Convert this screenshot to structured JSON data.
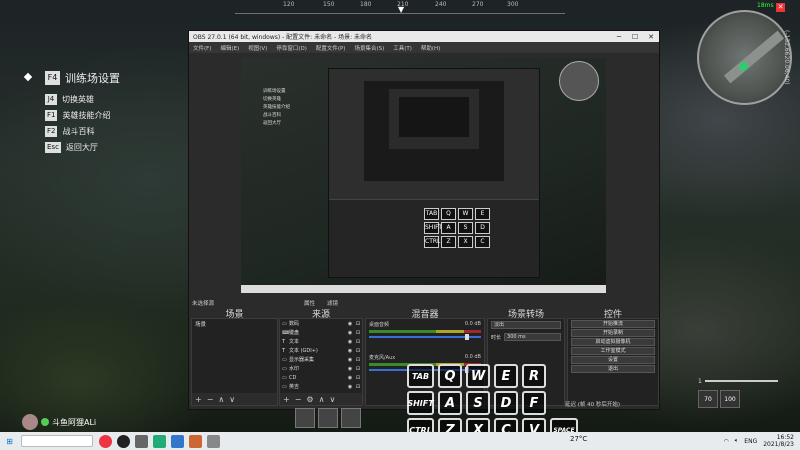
{
  "compass": {
    "ticks": [
      "120",
      "150",
      "180",
      "210",
      "240",
      "270",
      "300"
    ]
  },
  "hud_menu": {
    "main": {
      "key": "F4",
      "label": "训练场设置"
    },
    "items": [
      {
        "key": "J4",
        "label": "切换英雄"
      },
      {
        "key": "F1",
        "label": "英雄技能介绍"
      },
      {
        "key": "F2",
        "label": "战斗百科"
      },
      {
        "key": "Esc",
        "label": "返回大厅"
      }
    ]
  },
  "signal": "18ms",
  "coords": "(-132,6620.06,40)",
  "obs": {
    "title": "OBS 27.0.1 (64 bit, windows) - 配置文件: 未命名 - 场景: 未命名",
    "menu": [
      "文件(F)",
      "编辑(E)",
      "视图(V)",
      "停靠窗口(D)",
      "配置文件(P)",
      "场景集合(S)",
      "工具(T)",
      "帮助(H)"
    ],
    "scene_label": "未选择源",
    "properties": "属性",
    "filters": "滤镜",
    "dock_titles": [
      "场景",
      "来源",
      "混音器",
      "场景转场",
      "控件"
    ],
    "scenes": [
      "场景"
    ],
    "sources": [
      {
        "icon": "▭",
        "label": "数码"
      },
      {
        "icon": "⌨",
        "label": "键盘"
      },
      {
        "icon": "T",
        "label": "文本"
      },
      {
        "icon": "T",
        "label": "文本 (GDI+)"
      },
      {
        "icon": "▭",
        "label": "显示器采集"
      },
      {
        "icon": "▭",
        "label": "水印"
      },
      {
        "icon": "▭",
        "label": "CD"
      },
      {
        "icon": "▭",
        "label": "英吉"
      }
    ],
    "mixer": [
      {
        "name": "桌面音频",
        "db": "0.0 dB"
      },
      {
        "name": "麦克风/Aux",
        "db": "0.0 dB"
      }
    ],
    "transition": {
      "type": "淡出",
      "duration_label": "时长",
      "duration": "300 ms"
    },
    "controls": [
      "开始推流",
      "开始录制",
      "启动虚拟摄像机",
      "工作室模式",
      "设置",
      "退出"
    ],
    "status": "延迟 (帧 40 秒后开始)"
  },
  "preview_menu": [
    "训练场设置",
    "切换英雄",
    "英雄技能介绍",
    "战斗百科",
    "返回大厅"
  ],
  "preview_keys": [
    "TAB",
    "Q",
    "W",
    "E",
    "SHIFT",
    "A",
    "S",
    "D",
    "CTRL",
    "Z",
    "X",
    "C"
  ],
  "keys": {
    "row1": [
      "TAB",
      "Q",
      "W",
      "E",
      "R"
    ],
    "row2": [
      "SHIFT",
      "A",
      "S",
      "D",
      "F"
    ],
    "row3": [
      "CTRL",
      "Z",
      "X",
      "C",
      "V",
      "SPACE"
    ]
  },
  "streamer": "斗鱼阿狸ALi",
  "hp_level": "1",
  "level_boxes": [
    "70",
    "100"
  ],
  "taskbar": {
    "weather": "27°C",
    "lang": "ENG",
    "time": "16:52",
    "date": "2021/8/23"
  }
}
